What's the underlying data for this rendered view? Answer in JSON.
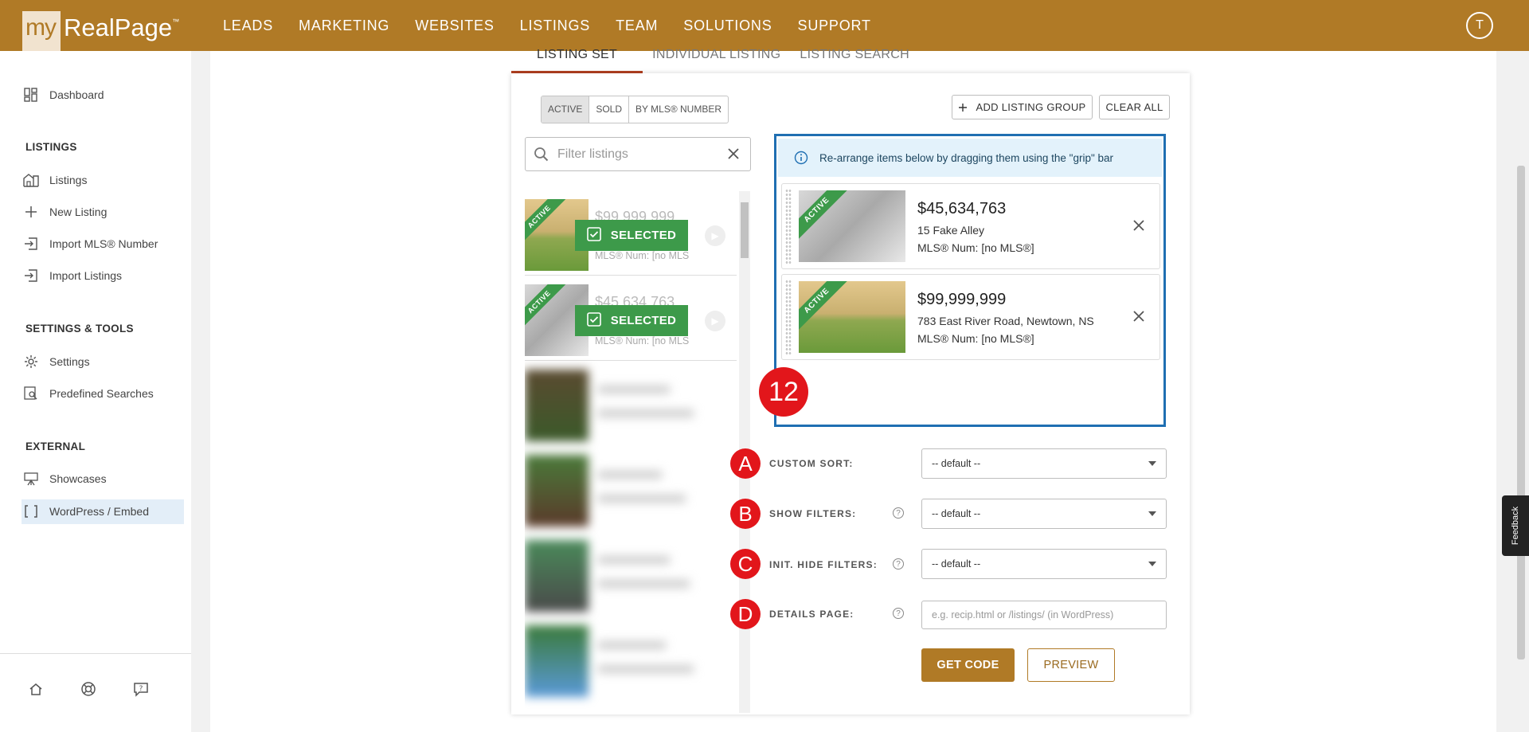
{
  "header": {
    "logo_my": "my",
    "logo_rest": "RealPage",
    "logo_tm": "™",
    "nav": [
      "LEADS",
      "MARKETING",
      "WEBSITES",
      "LISTINGS",
      "TEAM",
      "SOLUTIONS",
      "SUPPORT"
    ],
    "avatar_initial": "T",
    "brand_color": "#b07a26"
  },
  "sidebar": {
    "dashboard": "Dashboard",
    "listings_heading": "LISTINGS",
    "listings": "Listings",
    "new_listing": "New Listing",
    "import_mls": "Import MLS® Number",
    "import_listings": "Import Listings",
    "settings_heading": "SETTINGS & TOOLS",
    "settings": "Settings",
    "predefined_searches": "Predefined Searches",
    "external_heading": "EXTERNAL",
    "showcases": "Showcases",
    "wordpress_embed": "WordPress / Embed"
  },
  "tabs": [
    "LISTING SET",
    "INDIVIDUAL LISTING",
    "LISTING SEARCH"
  ],
  "status_filter": [
    "ACTIVE",
    "SOLD",
    "BY MLS® NUMBER"
  ],
  "actions": {
    "add_listing_group": "ADD LISTING GROUP",
    "clear_all": "CLEAR ALL"
  },
  "filter": {
    "placeholder": "Filter listings"
  },
  "listing_list": [
    {
      "price": "$99,999,999",
      "mls": "MLS® Num: [no MLS",
      "badge": "SELECTED",
      "ribbon": "ACTIVE"
    },
    {
      "price": "$45,634,763",
      "mls": "MLS® Num: [no MLS",
      "badge": "SELECTED",
      "ribbon": "ACTIVE"
    }
  ],
  "selected_panel": {
    "info": "Re-arrange items below by dragging them using the \"grip\" bar",
    "items": [
      {
        "price": "$45,634,763",
        "address": "15 Fake Alley",
        "mls": "MLS® Num: [no MLS®]",
        "ribbon": "ACTIVE"
      },
      {
        "price": "$99,999,999",
        "address": "783 East River Road, Newtown, NS",
        "mls": "MLS® Num: [no MLS®]",
        "ribbon": "ACTIVE"
      }
    ]
  },
  "markers": {
    "count": "12",
    "a": "A",
    "b": "B",
    "c": "C",
    "d": "D"
  },
  "form": {
    "custom_sort_label": "CUSTOM SORT:",
    "custom_sort_value": "-- default --",
    "show_filters_label": "SHOW FILTERS:",
    "show_filters_value": "-- default --",
    "init_hide_filters_label": "INIT. HIDE FILTERS:",
    "init_hide_filters_value": "-- default --",
    "details_page_label": "DETAILS PAGE:",
    "details_page_placeholder": "e.g. recip.html or /listings/ (in WordPress)",
    "help": "?",
    "get_code": "GET CODE",
    "preview": "PREVIEW"
  },
  "feedback": "Feedback"
}
